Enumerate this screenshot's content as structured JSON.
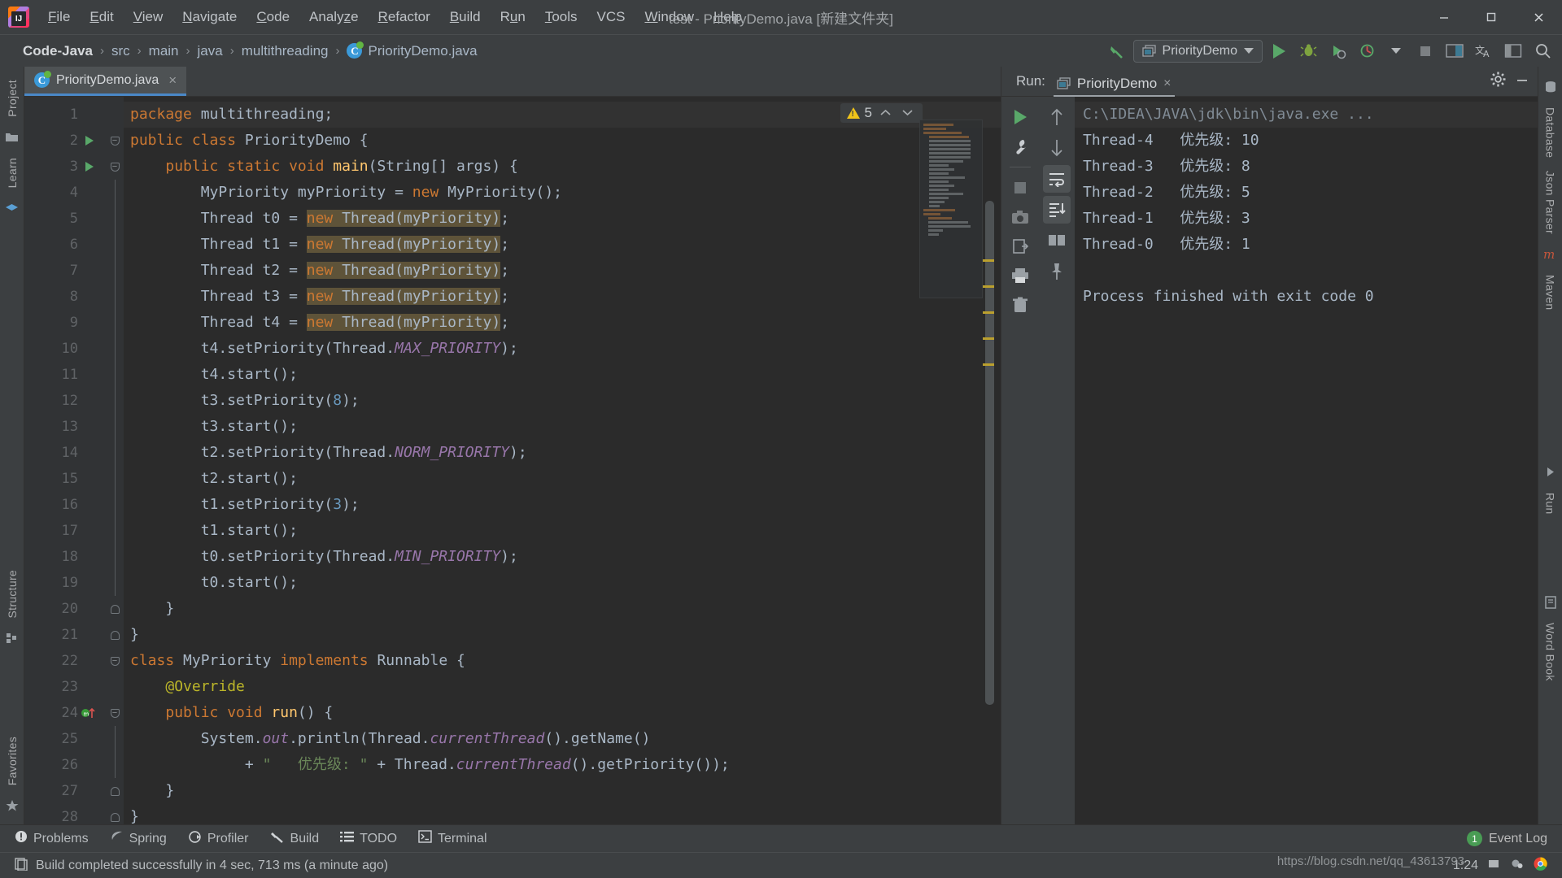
{
  "window": {
    "title": "test - PriorityDemo.java [新建文件夹]",
    "app_icon": "intellij-idea-logo",
    "controls": [
      "minimize",
      "maximize",
      "close"
    ]
  },
  "menu": [
    {
      "label": "File",
      "mnemonic": "F"
    },
    {
      "label": "Edit",
      "mnemonic": "E"
    },
    {
      "label": "View",
      "mnemonic": "V"
    },
    {
      "label": "Navigate",
      "mnemonic": "N"
    },
    {
      "label": "Code",
      "mnemonic": "C"
    },
    {
      "label": "Analyze",
      "mnemonic": "z"
    },
    {
      "label": "Refactor",
      "mnemonic": "R"
    },
    {
      "label": "Build",
      "mnemonic": "B"
    },
    {
      "label": "Run",
      "mnemonic": "u"
    },
    {
      "label": "Tools",
      "mnemonic": "T"
    },
    {
      "label": "VCS",
      "mnemonic": ""
    },
    {
      "label": "Window",
      "mnemonic": "W"
    },
    {
      "label": "Help",
      "mnemonic": "H"
    }
  ],
  "breadcrumb": {
    "items": [
      "Code-Java",
      "src",
      "main",
      "java",
      "multithreading",
      "PriorityDemo.java"
    ],
    "separator": "›",
    "file_icon": "java-class-icon"
  },
  "toolbar": {
    "back_icon": "build-hammer-icon",
    "run_config": "PriorityDemo",
    "run_config_icon": "application-config-icon",
    "dropdown_icon": "chevron-down-icon",
    "buttons": [
      "run-icon",
      "debug-icon",
      "run-with-coverage-icon",
      "profiler-icon",
      "profiler-dropdown-icon",
      "stop-icon",
      "open-terminal-icon",
      "translate-icon",
      "layout-icon",
      "search-everywhere-icon"
    ]
  },
  "left_strip": {
    "tabs": [
      "Project",
      "Learn",
      "Structure",
      "Favorites"
    ],
    "icons": [
      "project-icon",
      "database-icon",
      "learn-icon",
      "structure-icon",
      "favorites-icon"
    ]
  },
  "right_strip": {
    "tabs": [
      "Database",
      "Json Parser",
      "Maven",
      "Run",
      "Word Book"
    ]
  },
  "editor": {
    "tab": {
      "label": "PriorityDemo.java",
      "icon": "java-class-icon",
      "close": "×"
    },
    "inspection": {
      "warn_count": "5",
      "up": "⌃",
      "down": "⌄",
      "icon": "warning-triangle-icon"
    },
    "lines": [
      {
        "n": "1",
        "fold": "",
        "mark": "",
        "tokens": [
          [
            "kw",
            "package"
          ],
          [
            "plain",
            " multithreading;"
          ]
        ]
      },
      {
        "n": "2",
        "fold": "open",
        "mark": "run",
        "tokens": [
          [
            "kw",
            "public "
          ],
          [
            "kw",
            "class "
          ],
          [
            "plain",
            "PriorityDemo {"
          ]
        ]
      },
      {
        "n": "3",
        "fold": "open",
        "mark": "run",
        "tokens": [
          [
            "plain",
            "    "
          ],
          [
            "kw",
            "public "
          ],
          [
            "kw",
            "static "
          ],
          [
            "kw",
            "void "
          ],
          [
            "mth",
            "main"
          ],
          [
            "plain",
            "(String[] args) {"
          ]
        ]
      },
      {
        "n": "4",
        "fold": "bar",
        "mark": "",
        "tokens": [
          [
            "plain",
            "        MyPriority myPriority = "
          ],
          [
            "kw",
            "new "
          ],
          [
            "plain",
            "MyPriority();"
          ]
        ]
      },
      {
        "n": "5",
        "fold": "bar",
        "mark": "",
        "tokens": [
          [
            "plain",
            "        Thread t0 = "
          ],
          [
            "hlkw",
            "new "
          ],
          [
            "hl",
            "Thread(myPriority)"
          ],
          [
            "plain",
            ";"
          ]
        ]
      },
      {
        "n": "6",
        "fold": "bar",
        "mark": "",
        "tokens": [
          [
            "plain",
            "        Thread t1 = "
          ],
          [
            "hlkw",
            "new "
          ],
          [
            "hl",
            "Thread(myPriority)"
          ],
          [
            "plain",
            ";"
          ]
        ]
      },
      {
        "n": "7",
        "fold": "bar",
        "mark": "",
        "tokens": [
          [
            "plain",
            "        Thread t2 = "
          ],
          [
            "hlkw",
            "new "
          ],
          [
            "hl",
            "Thread(myPriority)"
          ],
          [
            "plain",
            ";"
          ]
        ]
      },
      {
        "n": "8",
        "fold": "bar",
        "mark": "",
        "tokens": [
          [
            "plain",
            "        Thread t3 = "
          ],
          [
            "hlkw",
            "new "
          ],
          [
            "hl",
            "Thread(myPriority)"
          ],
          [
            "plain",
            ";"
          ]
        ]
      },
      {
        "n": "9",
        "fold": "bar",
        "mark": "",
        "tokens": [
          [
            "plain",
            "        Thread t4 = "
          ],
          [
            "hlkw",
            "new "
          ],
          [
            "hl",
            "Thread(myPriority)"
          ],
          [
            "plain",
            ";"
          ]
        ]
      },
      {
        "n": "10",
        "fold": "bar",
        "mark": "",
        "tokens": [
          [
            "plain",
            "        t4.setPriority(Thread."
          ],
          [
            "stat",
            "MAX_PRIORITY"
          ],
          [
            "plain",
            ");"
          ]
        ]
      },
      {
        "n": "11",
        "fold": "bar",
        "mark": "",
        "tokens": [
          [
            "plain",
            "        t4.start();"
          ]
        ]
      },
      {
        "n": "12",
        "fold": "bar",
        "mark": "",
        "tokens": [
          [
            "plain",
            "        t3.setPriority("
          ],
          [
            "num",
            "8"
          ],
          [
            "plain",
            ");"
          ]
        ]
      },
      {
        "n": "13",
        "fold": "bar",
        "mark": "",
        "tokens": [
          [
            "plain",
            "        t3.start();"
          ]
        ]
      },
      {
        "n": "14",
        "fold": "bar",
        "mark": "",
        "tokens": [
          [
            "plain",
            "        t2.setPriority(Thread."
          ],
          [
            "stat",
            "NORM_PRIORITY"
          ],
          [
            "plain",
            ");"
          ]
        ]
      },
      {
        "n": "15",
        "fold": "bar",
        "mark": "",
        "tokens": [
          [
            "plain",
            "        t2.start();"
          ]
        ]
      },
      {
        "n": "16",
        "fold": "bar",
        "mark": "",
        "tokens": [
          [
            "plain",
            "        t1.setPriority("
          ],
          [
            "num",
            "3"
          ],
          [
            "plain",
            ");"
          ]
        ]
      },
      {
        "n": "17",
        "fold": "bar",
        "mark": "",
        "tokens": [
          [
            "plain",
            "        t1.start();"
          ]
        ]
      },
      {
        "n": "18",
        "fold": "bar",
        "mark": "",
        "tokens": [
          [
            "plain",
            "        t0.setPriority(Thread."
          ],
          [
            "stat",
            "MIN_PRIORITY"
          ],
          [
            "plain",
            ");"
          ]
        ]
      },
      {
        "n": "19",
        "fold": "bar",
        "mark": "",
        "tokens": [
          [
            "plain",
            "        t0.start();"
          ]
        ]
      },
      {
        "n": "20",
        "fold": "close",
        "mark": "",
        "tokens": [
          [
            "plain",
            "    }"
          ]
        ]
      },
      {
        "n": "21",
        "fold": "close",
        "mark": "",
        "tokens": [
          [
            "plain",
            "}"
          ]
        ]
      },
      {
        "n": "22",
        "fold": "open",
        "mark": "",
        "tokens": [
          [
            "kw",
            "class "
          ],
          [
            "plain",
            "MyPriority "
          ],
          [
            "kw",
            "implements "
          ],
          [
            "plain",
            "Runnable {"
          ]
        ]
      },
      {
        "n": "23",
        "fold": "",
        "mark": "",
        "tokens": [
          [
            "plain",
            "    "
          ],
          [
            "ann",
            "@Override"
          ]
        ]
      },
      {
        "n": "24",
        "fold": "open",
        "mark": "over",
        "tokens": [
          [
            "plain",
            "    "
          ],
          [
            "kw",
            "public "
          ],
          [
            "kw",
            "void "
          ],
          [
            "mth",
            "run"
          ],
          [
            "plain",
            "() {"
          ]
        ]
      },
      {
        "n": "25",
        "fold": "bar",
        "mark": "",
        "tokens": [
          [
            "plain",
            "        System."
          ],
          [
            "stat",
            "out"
          ],
          [
            "plain",
            ".println(Thread."
          ],
          [
            "stat",
            "currentThread"
          ],
          [
            "plain",
            "().getName()"
          ]
        ]
      },
      {
        "n": "26",
        "fold": "bar",
        "mark": "",
        "tokens": [
          [
            "plain",
            "             + "
          ],
          [
            "str",
            "\"   优先级: \""
          ],
          [
            "plain",
            " + Thread."
          ],
          [
            "stat",
            "currentThread"
          ],
          [
            "plain",
            "().getPriority());"
          ]
        ]
      },
      {
        "n": "27",
        "fold": "close",
        "mark": "",
        "tokens": [
          [
            "plain",
            "    }"
          ]
        ]
      },
      {
        "n": "28",
        "fold": "close",
        "mark": "",
        "tokens": [
          [
            "plain",
            "}"
          ]
        ]
      }
    ]
  },
  "run_panel": {
    "label": "Run:",
    "tab": {
      "title": "PriorityDemo",
      "icon": "application-config-icon",
      "close": "×"
    },
    "header_icons": [
      "settings-gear-icon",
      "minimize-icon"
    ],
    "tool_icons": [
      "rerun-icon",
      "rerun-failed-wrench-icon",
      "stop-icon",
      "screenshot-camera-icon",
      "export-icon",
      "print-icon",
      "trash-icon"
    ],
    "tool_icons2": [
      "scroll-up-icon",
      "scroll-down-icon",
      "soft-wrap-icon",
      "scroll-to-end-icon",
      "layout-split-icon",
      "pin-tab-icon"
    ],
    "console_lines": [
      {
        "text": "C:\\IDEA\\JAVA\\jdk\\bin\\java.exe ...",
        "style": "cmd"
      },
      {
        "text": "Thread-4   优先级: 10",
        "style": "out"
      },
      {
        "text": "Thread-3   优先级: 8",
        "style": "out"
      },
      {
        "text": "Thread-2   优先级: 5",
        "style": "out"
      },
      {
        "text": "Thread-1   优先级: 3",
        "style": "out"
      },
      {
        "text": "Thread-0   优先级: 1",
        "style": "out"
      },
      {
        "text": "",
        "style": "out"
      },
      {
        "text": "Process finished with exit code 0",
        "style": "out"
      }
    ]
  },
  "bottom_toolbar": {
    "items": [
      {
        "label": "Problems",
        "icon": "problems-icon"
      },
      {
        "label": "Spring",
        "icon": "spring-leaf-icon"
      },
      {
        "label": "Profiler",
        "icon": "profiler-icon"
      },
      {
        "label": "Build",
        "icon": "build-hammer-icon"
      },
      {
        "label": "TODO",
        "icon": "todo-list-icon"
      },
      {
        "label": "Terminal",
        "icon": "terminal-icon"
      }
    ],
    "event_log": {
      "label": "Event Log",
      "count": "1",
      "icon": "event-log-icon"
    }
  },
  "statusbar": {
    "message": "Build completed successfully in 4 sec, 713 ms (a minute ago)",
    "icon": "build-status-icon",
    "watermark": "https://blog.csdn.net/qq_43613793",
    "tray_time": "1:24",
    "tray_icons": [
      "ime-icon",
      "settings-icon",
      "chrome-icon"
    ]
  },
  "colors": {
    "accent_blue": "#4a88c7",
    "run_green": "#59a869",
    "keyword_orange": "#cc7832",
    "string_green": "#6a8759",
    "static_purple": "#9876aa",
    "annotation_yellow": "#bbb529",
    "warn_yellow": "#f0c419",
    "highlight": "#5e5339",
    "editor_bg": "#2b2b2b",
    "chrome_bg": "#3c3f41"
  }
}
